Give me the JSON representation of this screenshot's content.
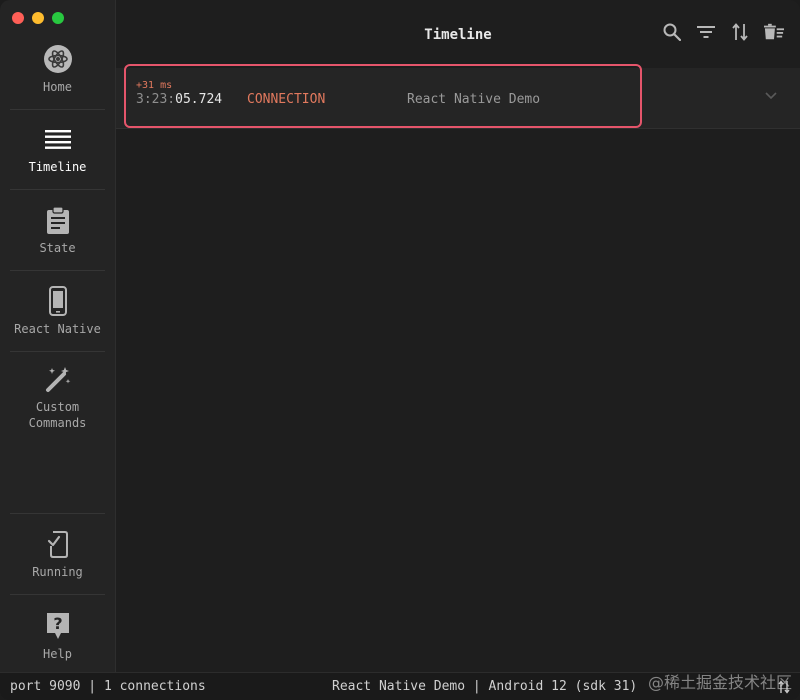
{
  "window": {
    "title": "Timeline"
  },
  "sidebar": {
    "items": [
      {
        "label": "Home",
        "icon": "reactotron-logo-icon"
      },
      {
        "label": "Timeline",
        "icon": "list-icon",
        "active": true
      },
      {
        "label": "State",
        "icon": "clipboard-icon"
      },
      {
        "label": "React Native",
        "icon": "phone-icon"
      },
      {
        "label": "Custom\nCommands",
        "icon": "magic-wand-icon"
      }
    ],
    "bottom_items": [
      {
        "label": "Running",
        "icon": "phone-check-icon"
      },
      {
        "label": "Help",
        "icon": "help-icon"
      }
    ]
  },
  "header": {
    "actions": [
      "search-icon",
      "filter-icon",
      "sort-icon",
      "clear-icon"
    ]
  },
  "timeline": {
    "rows": [
      {
        "delta": "+31 ms",
        "time_dim": "3:23:",
        "time_bright": "05.724",
        "type": "CONNECTION",
        "title": "React Native Demo"
      }
    ]
  },
  "status": {
    "port": "port 9090",
    "connections": "1 connections",
    "app": "React Native Demo",
    "platform": "Android 12 (sdk 31)",
    "separator": "|"
  },
  "watermark": "@稀土掘金技术社区",
  "colors": {
    "accent": "#e2795e",
    "highlight": "#e5556b",
    "background": "#1e1e1e",
    "sidebar": "#242424"
  }
}
